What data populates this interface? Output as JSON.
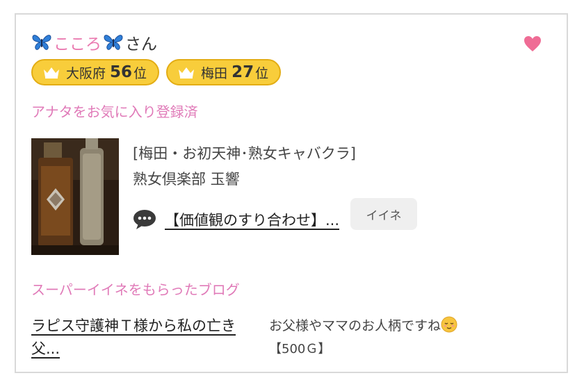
{
  "user": {
    "name": "こころ",
    "suffix": "さん"
  },
  "badges": [
    {
      "area": "大阪府",
      "rank": "56",
      "suffix": "位"
    },
    {
      "area": "梅田",
      "rank": "27",
      "suffix": "位"
    }
  ],
  "favorite_status": "アナタをお気に入り登録済",
  "shop": {
    "category": "[梅田・お初天神･熟女キャバクラ]",
    "name": "熟女倶楽部 玉響"
  },
  "latest_post": {
    "title": "【価値観のすり合わせ】...",
    "like_button_label": "イイネ"
  },
  "super_iine": {
    "heading": "スーパーイイネをもらったブログ",
    "blog_title": "ラピス守護神Ｔ様から私の亡き父...",
    "comment": "お父様やママのお人柄ですね",
    "amount": "【500Ｇ】"
  },
  "colors": {
    "accent_pink": "#e07ab8",
    "badge_gold": "#f8cd3b",
    "heart": "#ef6c95"
  },
  "icons": {
    "name_decoration": "butterfly-icon",
    "favorite": "heart-icon",
    "rank": "crown-icon",
    "comment": "speech-bubble-icon",
    "emoji": "relieved-face-emoji"
  }
}
